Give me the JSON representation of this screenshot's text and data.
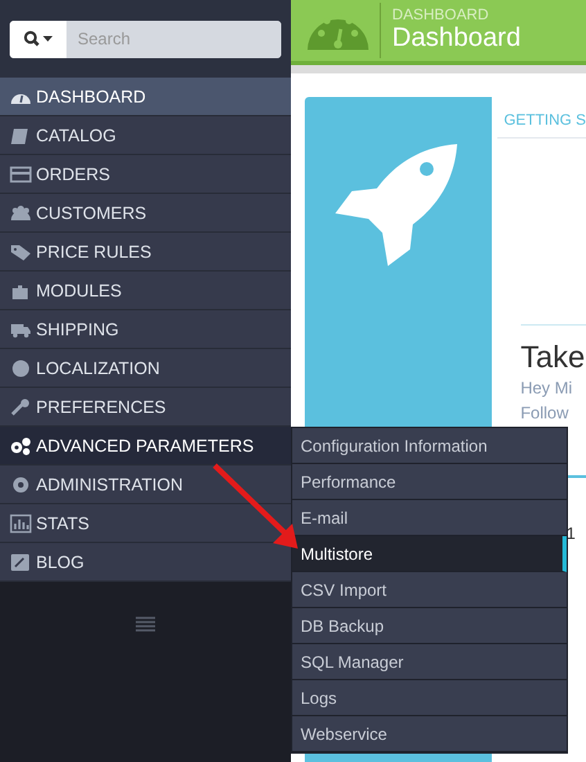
{
  "search": {
    "placeholder": "Search"
  },
  "header": {
    "breadcrumb": "DASHBOARD",
    "title": "Dashboard"
  },
  "menu": [
    {
      "label": "DASHBOARD",
      "selected": true,
      "expanded": false
    },
    {
      "label": "CATALOG",
      "selected": false,
      "expanded": false
    },
    {
      "label": "ORDERS",
      "selected": false,
      "expanded": false
    },
    {
      "label": "CUSTOMERS",
      "selected": false,
      "expanded": false
    },
    {
      "label": "PRICE RULES",
      "selected": false,
      "expanded": false
    },
    {
      "label": "MODULES",
      "selected": false,
      "expanded": false
    },
    {
      "label": "SHIPPING",
      "selected": false,
      "expanded": false
    },
    {
      "label": "LOCALIZATION",
      "selected": false,
      "expanded": false
    },
    {
      "label": "PREFERENCES",
      "selected": false,
      "expanded": false
    },
    {
      "label": "ADVANCED PARAMETERS",
      "selected": false,
      "expanded": true,
      "submenu": [
        {
          "label": "Configuration Information",
          "selected": false
        },
        {
          "label": "Performance",
          "selected": false
        },
        {
          "label": "E-mail",
          "selected": false
        },
        {
          "label": "Multistore",
          "selected": true
        },
        {
          "label": "CSV Import",
          "selected": false
        },
        {
          "label": "DB Backup",
          "selected": false
        },
        {
          "label": "SQL Manager",
          "selected": false
        },
        {
          "label": "Logs",
          "selected": false
        },
        {
          "label": "Webservice",
          "selected": false
        }
      ]
    },
    {
      "label": "ADMINISTRATION",
      "selected": false,
      "expanded": false
    },
    {
      "label": "STATS",
      "selected": false,
      "expanded": false
    },
    {
      "label": "BLOG",
      "selected": false,
      "expanded": false
    }
  ],
  "card": {
    "tab": "GETTING S",
    "heading": "Take",
    "lines": [
      "Hey Mi",
      "Follow"
    ]
  },
  "side_value": "1"
}
